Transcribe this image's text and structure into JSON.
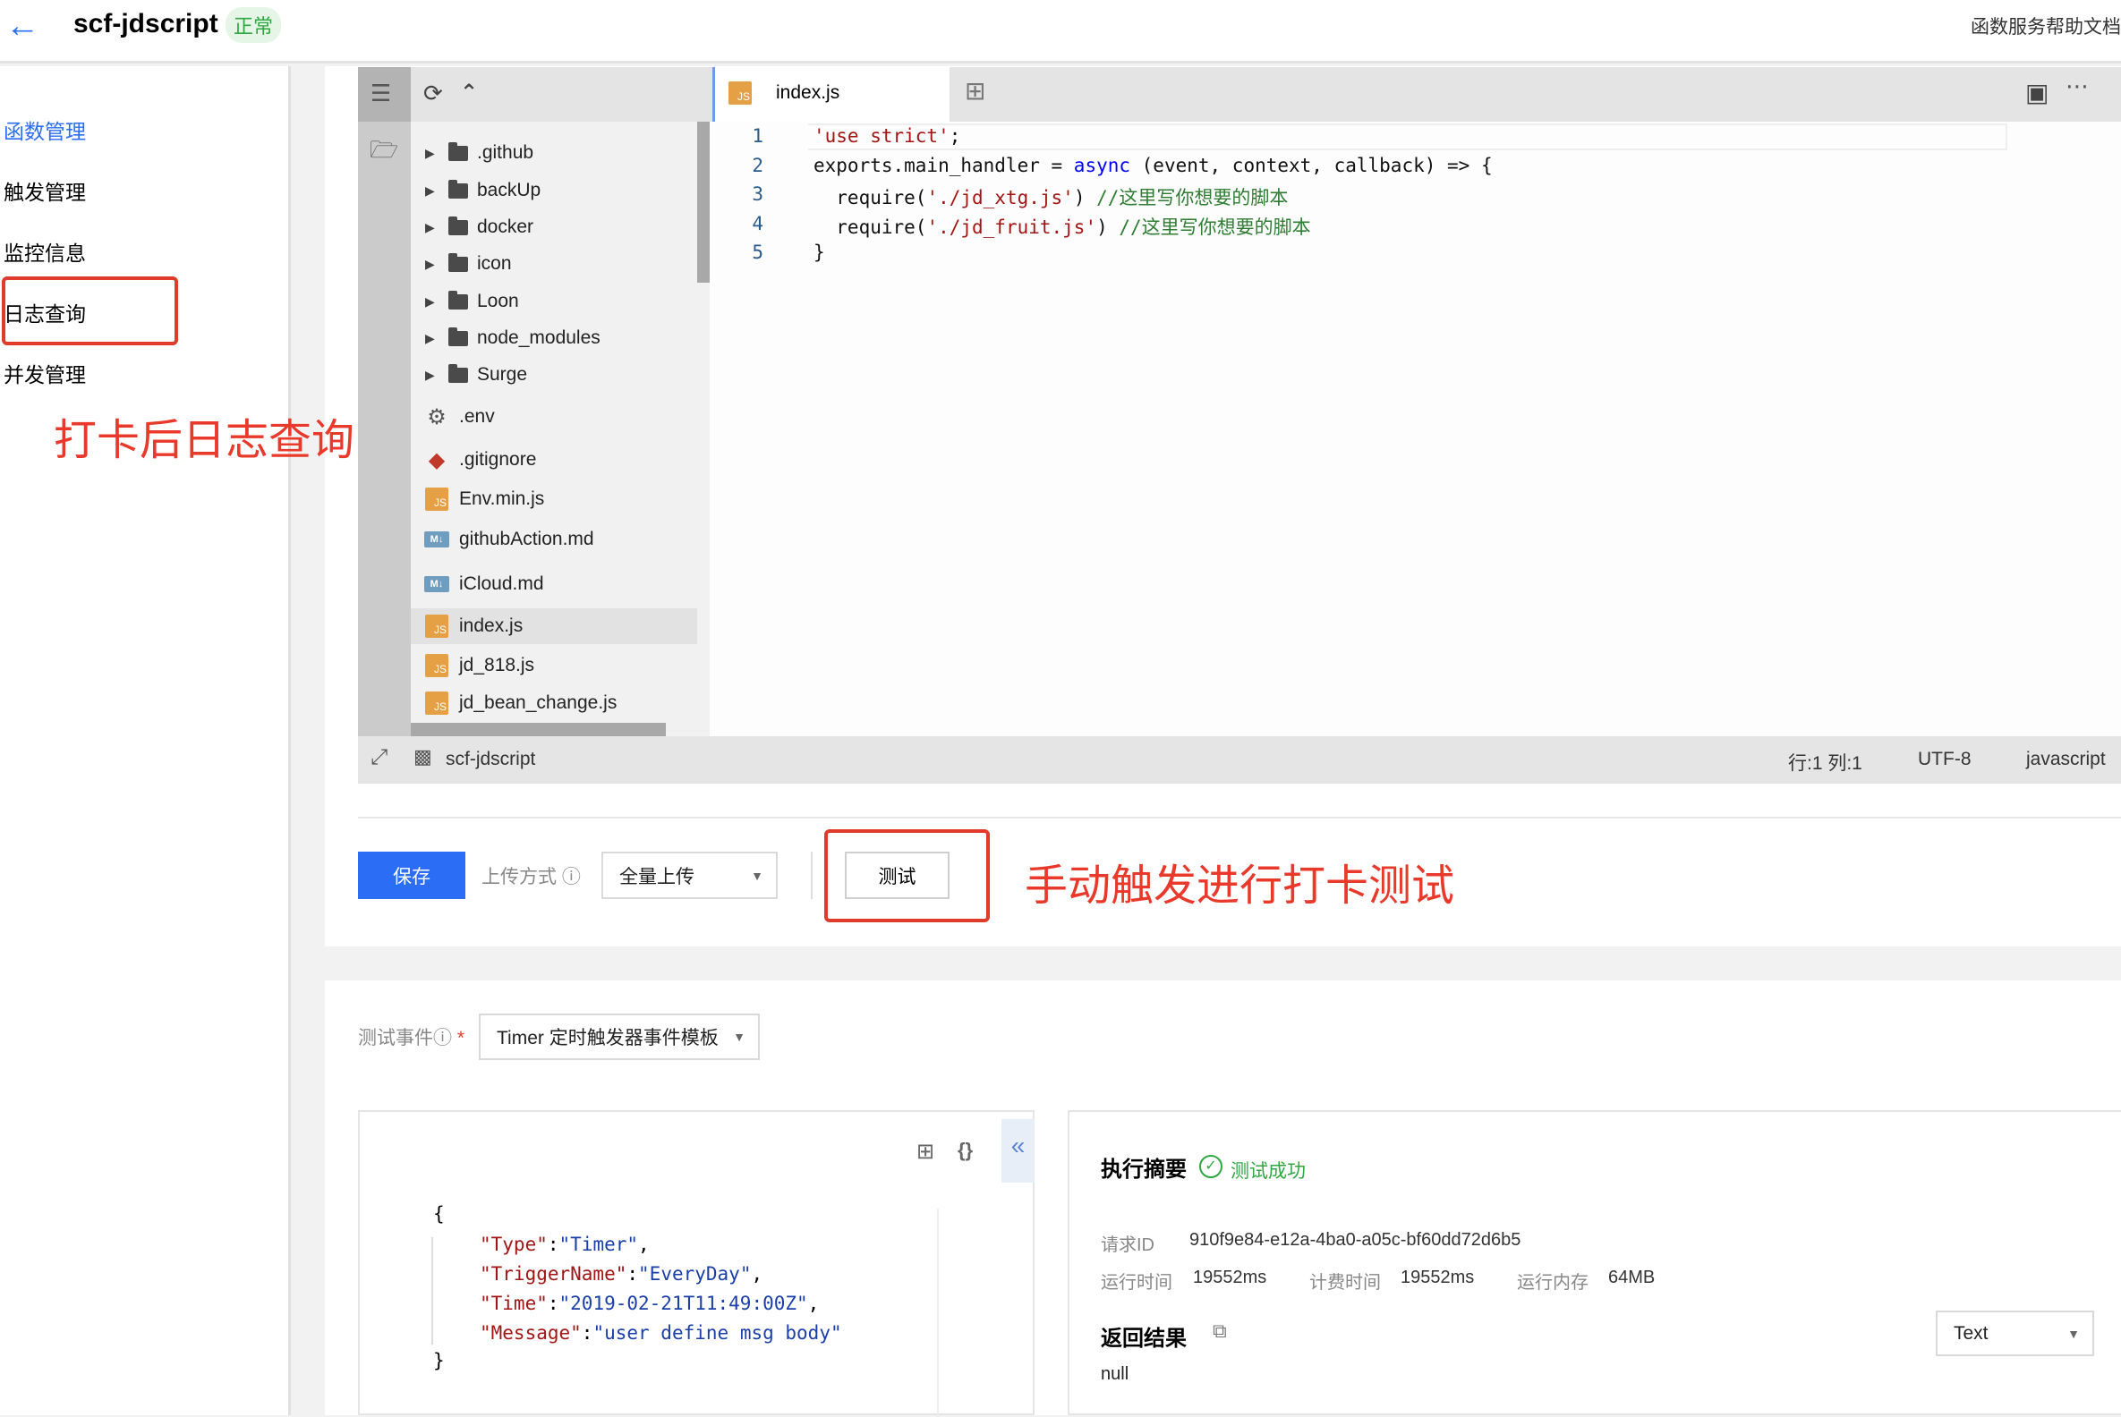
{
  "header": {
    "title": "scf-jdscript",
    "status": "正常",
    "help_link": "函数服务帮助文档",
    "back_icon": "arrow-left-icon"
  },
  "sidebar": {
    "items": [
      {
        "label": "函数管理",
        "active": true
      },
      {
        "label": "触发管理"
      },
      {
        "label": "监控信息"
      },
      {
        "label": "日志查询"
      },
      {
        "label": "并发管理"
      }
    ]
  },
  "annotations": {
    "log_query": "打卡后日志查询",
    "manual_test": "手动触发进行打卡测试"
  },
  "editor": {
    "active_tab": "index.js",
    "files": [
      {
        "name": ".github",
        "type": "folder"
      },
      {
        "name": "backUp",
        "type": "folder"
      },
      {
        "name": "docker",
        "type": "folder"
      },
      {
        "name": "icon",
        "type": "folder"
      },
      {
        "name": "Loon",
        "type": "folder"
      },
      {
        "name": "node_modules",
        "type": "folder"
      },
      {
        "name": "Surge",
        "type": "folder"
      },
      {
        "name": ".env",
        "type": "gear"
      },
      {
        "name": ".gitignore",
        "type": "git"
      },
      {
        "name": "Env.min.js",
        "type": "js"
      },
      {
        "name": "githubAction.md",
        "type": "md"
      },
      {
        "name": "iCloud.md",
        "type": "md"
      },
      {
        "name": "index.js",
        "type": "js",
        "selected": true
      },
      {
        "name": "jd_818.js",
        "type": "js"
      },
      {
        "name": "jd_bean_change.js",
        "type": "js"
      }
    ],
    "code_lines": [
      "'use strict';",
      "exports.main_handler = async (event, context, callback) => {",
      "  require('./jd_xtg.js') //这里写你想要的脚本",
      "  require('./jd_fruit.js') //这里写你想要的脚本",
      "}"
    ],
    "status": {
      "project": "scf-jdscript",
      "position": "行:1 列:1",
      "encoding": "UTF-8",
      "language": "javascript"
    }
  },
  "toolbar": {
    "save": "保存",
    "upload_label": "上传方式",
    "upload_value": "全量上传",
    "test": "测试"
  },
  "test": {
    "event_label": "测试事件",
    "event_value": "Timer 定时触发器事件模板",
    "event_json": [
      "{",
      "\"Type\":\"Timer\",",
      "\"TriggerName\":\"EveryDay\",",
      "\"Time\":\"2019-02-21T11:49:00Z\",",
      "\"Message\":\"user define msg body\"",
      "}"
    ],
    "summary_title": "执行摘要",
    "result_status": "测试成功",
    "request_id_label": "请求ID",
    "request_id": "910f9e84-e12a-4ba0-a05c-bf60dd72d6b5",
    "run_time_label": "运行时间",
    "run_time": "19552ms",
    "billed_time_label": "计费时间",
    "billed_time": "19552ms",
    "memory_label": "运行内存",
    "memory": "64MB",
    "return_title": "返回结果",
    "return_value": "null",
    "format": "Text"
  },
  "colors": {
    "accent": "#2b6ef5",
    "success": "#2fa742",
    "annotation": "#e8392b"
  }
}
